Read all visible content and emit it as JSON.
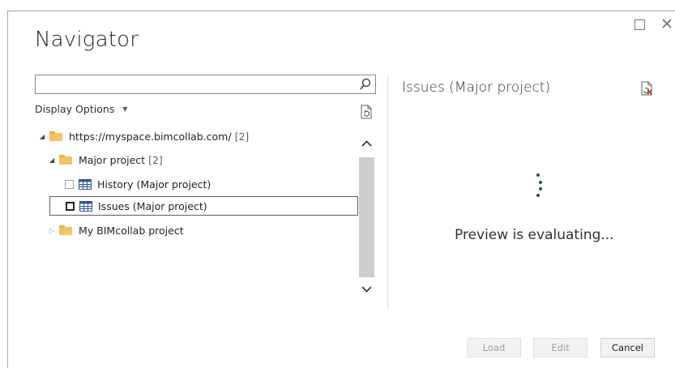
{
  "window": {
    "title": "Navigator"
  },
  "search": {
    "value": "",
    "placeholder": ""
  },
  "display_options": {
    "label": "Display Options"
  },
  "tree": {
    "root": {
      "label": "https://myspace.bimcollab.com/",
      "count": "[2]",
      "expanded": true
    },
    "major_project": {
      "label": "Major project",
      "count": "[2]",
      "expanded": true
    },
    "history": {
      "label": "History (Major project)",
      "checked": false
    },
    "issues": {
      "label": "Issues (Major project)",
      "checked": false,
      "selected": true
    },
    "my_bimcollab": {
      "label": "My BIMcollab project",
      "expanded": false
    }
  },
  "preview": {
    "title": "Issues (Major project)",
    "status": "Preview is evaluating..."
  },
  "buttons": {
    "load": "Load",
    "edit": "Edit",
    "cancel": "Cancel"
  },
  "icons": {
    "search": "search-icon",
    "refresh": "refresh-icon",
    "folder": "folder-icon",
    "table": "table-icon",
    "export": "export-icon"
  },
  "colors": {
    "folder": "#f2c567",
    "spinner": "#1f5c38",
    "table_icon": "#2b579a"
  }
}
